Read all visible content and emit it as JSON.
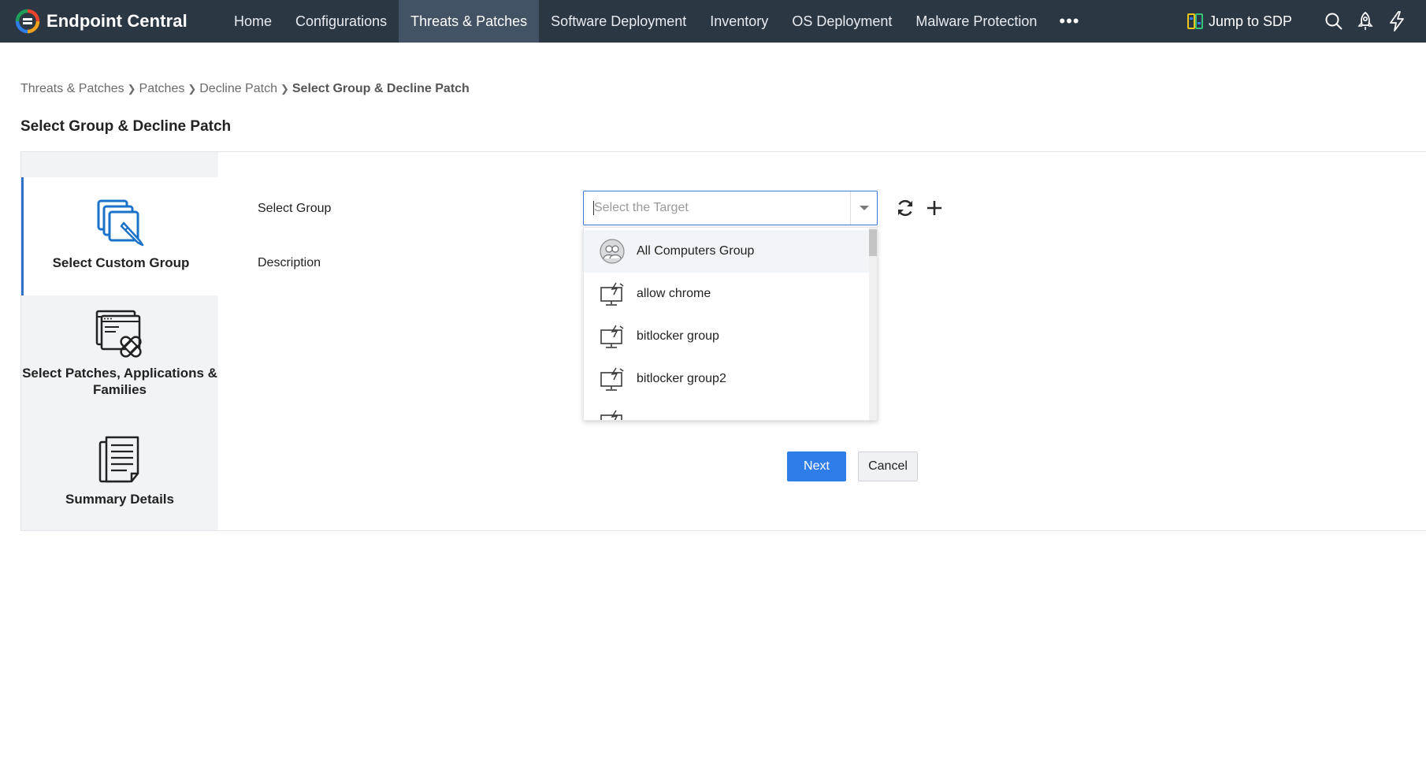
{
  "app": {
    "brand": "Endpoint Central"
  },
  "nav": {
    "items": [
      {
        "label": "Home"
      },
      {
        "label": "Configurations"
      },
      {
        "label": "Threats & Patches"
      },
      {
        "label": "Software Deployment"
      },
      {
        "label": "Inventory"
      },
      {
        "label": "OS Deployment"
      },
      {
        "label": "Malware Protection"
      }
    ],
    "more_glyph": "•••",
    "jump_label": "Jump to SDP",
    "icons": [
      "search-icon",
      "rocket-icon",
      "lightning-icon"
    ],
    "active": "Threats & Patches"
  },
  "breadcrumb": {
    "items": [
      "Threats & Patches",
      "Patches",
      "Decline Patch"
    ],
    "current": "Select Group & Decline Patch"
  },
  "page": {
    "title": "Select Group & Decline Patch"
  },
  "steps": [
    {
      "label": "Select Custom Group",
      "icon": "custom-group-icon",
      "active": true
    },
    {
      "label": "Select Patches, Applications & Families",
      "icon": "patches-icon",
      "active": false
    },
    {
      "label": "Summary Details",
      "icon": "summary-document-icon",
      "active": false
    }
  ],
  "form": {
    "group_label": "Select Group",
    "description_label": "Description",
    "select_placeholder": "Select the Target",
    "select_value": ""
  },
  "dropdown": {
    "options": [
      {
        "label": "All Computers Group",
        "icon": "users-group-icon"
      },
      {
        "label": "allow chrome",
        "icon": "computer-group-icon"
      },
      {
        "label": "bitlocker group",
        "icon": "computer-group-icon"
      },
      {
        "label": "bitlocker group2",
        "icon": "computer-group-icon"
      }
    ]
  },
  "buttons": {
    "next": "Next",
    "cancel": "Cancel"
  },
  "colors": {
    "topbar": "#2c3744",
    "nav_active": "#435264",
    "primary": "#2f7de8",
    "step_accent": "#2f6fce"
  }
}
